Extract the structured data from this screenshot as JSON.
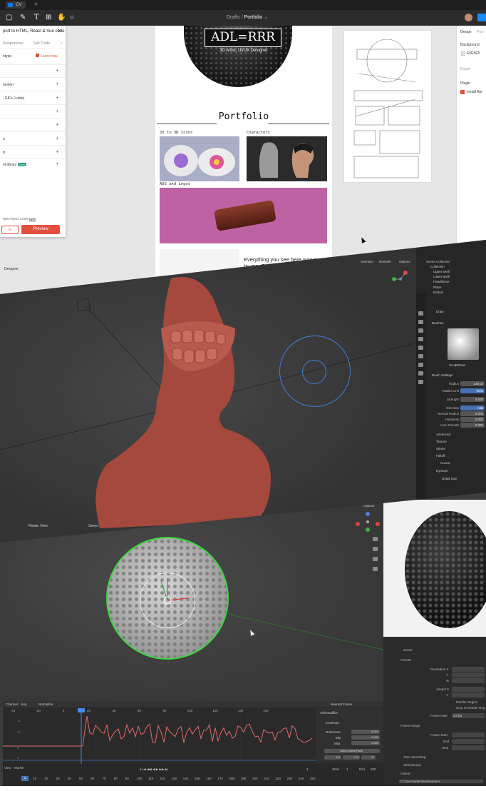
{
  "design_tool": {
    "window_tab": "CV",
    "breadcrumb": {
      "project": "Drafts",
      "separator": "/",
      "file": "Portfolio",
      "chevron": "⌄"
    },
    "plugin": {
      "title": "port to HTML, React & Vue code",
      "tabs": [
        "Responsive",
        "Get Code"
      ],
      "learn_label": "Learn how",
      "rows": [
        "otype",
        "motion",
        ", GIFs, Lottie)",
        "n",
        "d",
        "nt library"
      ],
      "new_badge": "New",
      "footer_date": "08/07/2022 13:09",
      "footer_link": "Sync",
      "export_label": "ts",
      "preview_label": "Preview"
    },
    "left_label": "Designer",
    "frame": {
      "logo": "ADL=RRR",
      "subtitle": "3D Artist, UI/UX Designer",
      "title": "Portfolio",
      "section_icons": "2D to 3D Icons",
      "section_characters": "Characters",
      "section_ads": "ADS and Logos",
      "paragraph_line1": "Everything you see here was p",
      "paragraph_line2": "by me. Enjoy! :"
    },
    "right_panel": {
      "tabs": [
        "Design",
        "Prot"
      ],
      "background": "Background",
      "color_hex": "E5E5E5",
      "export": "Export",
      "plugin": "Plugin",
      "install": "Install Ani"
    }
  },
  "sculpt": {
    "header": [
      "Overlays",
      "Remesh",
      "Options"
    ],
    "outliner": [
      "Scene Collection",
      "Collection",
      "Upper teeth",
      "Lower teeth",
      "Head/Bone",
      "Plane",
      "Bottom"
    ],
    "tool_name": "Draw",
    "brushes": "Brushes",
    "brush_name": "SculptDraw",
    "brush_settings": "Brush Settings",
    "props": [
      {
        "label": "Radius",
        "value": "135 px"
      },
      {
        "label": "Radius Unit",
        "value": "View",
        "blue": true
      },
      {
        "label": "Strength",
        "value": "0.500"
      },
      {
        "label": "Direction",
        "value": "Add",
        "blue": true
      },
      {
        "label": "Normal Radius",
        "value": "0.500"
      },
      {
        "label": "Hardness",
        "value": "0.000"
      },
      {
        "label": "Auto-Smooth",
        "value": "0.000"
      }
    ],
    "sections": [
      "Advanced",
      "Texture",
      "Stroke",
      "Falloff",
      "Cursor",
      "Dyntopo"
    ],
    "detail_size": "Detail Size",
    "footer": [
      "Rotate View",
      "Select"
    ]
  },
  "modelling": {
    "options": "Options",
    "scene_label": "Scene",
    "format": "Format",
    "fields": [
      {
        "label": "Resolution X",
        "value": ""
      },
      {
        "label": "Y",
        "value": ""
      },
      {
        "label": "%",
        "value": ""
      },
      {
        "label": "Aspect X",
        "value": ""
      },
      {
        "label": "Y",
        "value": ""
      }
    ],
    "render_region": "Render Region",
    "crop": "Crop to Render Reg",
    "frame_rate_label": "Frame Rate",
    "frame_rate": "24 fps",
    "frame_range": "Frame Range",
    "frame_start": "Frame Start",
    "frame_end": "End",
    "frame_step": "Step",
    "time_stretching": "Time Stretching",
    "stereoscopy": "Stereoscopy",
    "output": "Output",
    "output_path": "C:\\Users\\adler\\Desktop\\test",
    "graph_header": [
      "Channel",
      "Key",
      "Normalize"
    ],
    "nearest_frame": "Nearest Frame",
    "graph_ticks": [
      "-40",
      "-20",
      "0",
      "20",
      "40",
      "60",
      "80",
      "100",
      "120",
      "140",
      "160"
    ],
    "graph_y": [
      "12",
      "10",
      "5",
      "0"
    ],
    "modifier": "Add Modifier",
    "envelope": "Envelope",
    "mod_fields": [
      {
        "label": "Reference",
        "value": "0.000"
      },
      {
        "label": "Min",
        "value": "-1.000"
      },
      {
        "label": "Max",
        "value": "1.000"
      }
    ],
    "control_point": "Add Control Point",
    "cp_values": [
      "1.0",
      "-0.1",
      "11"
    ],
    "timeline": [
      "View",
      "Marker"
    ],
    "current_frame": "1",
    "start_label": "Start",
    "start": "1",
    "end_label": "End",
    "end": "250",
    "timeline_ticks": [
      "0",
      "10",
      "20",
      "30",
      "40",
      "50",
      "60",
      "70",
      "80",
      "90",
      "100",
      "110",
      "120",
      "130",
      "140",
      "150",
      "160",
      "170",
      "180",
      "190",
      "200",
      "210",
      "220",
      "230",
      "240",
      "250"
    ]
  }
}
